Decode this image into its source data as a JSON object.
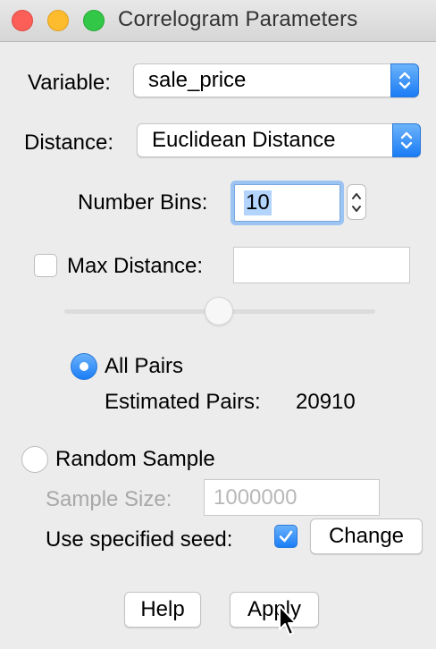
{
  "window": {
    "title": "Correlogram Parameters"
  },
  "form": {
    "variable_label": "Variable:",
    "variable_value": "sale_price",
    "distance_label": "Distance:",
    "distance_value": "Euclidean Distance",
    "number_bins_label": "Number Bins:",
    "number_bins_value": "10",
    "max_distance_label": "Max Distance:",
    "max_distance_checked": false,
    "max_distance_value": "",
    "all_pairs_label": "All Pairs",
    "all_pairs_selected": true,
    "estimated_pairs_label": "Estimated Pairs:",
    "estimated_pairs_value": "20910",
    "random_sample_label": "Random Sample",
    "random_sample_selected": false,
    "sample_size_label": "Sample Size:",
    "sample_size_value": "1000000",
    "use_seed_label": "Use specified seed:",
    "use_seed_checked": true,
    "change_label": "Change"
  },
  "buttons": {
    "help_label": "Help",
    "apply_label": "Apply"
  },
  "colors": {
    "accent": "#1b7ef6",
    "close": "#fc5f57",
    "minimize": "#fdbc2e",
    "zoom": "#33c748"
  },
  "icons": {
    "popup_arrows": "chevron-up-down-icon",
    "checkmark": "checkmark-icon",
    "cursor": "arrow-cursor-icon"
  }
}
